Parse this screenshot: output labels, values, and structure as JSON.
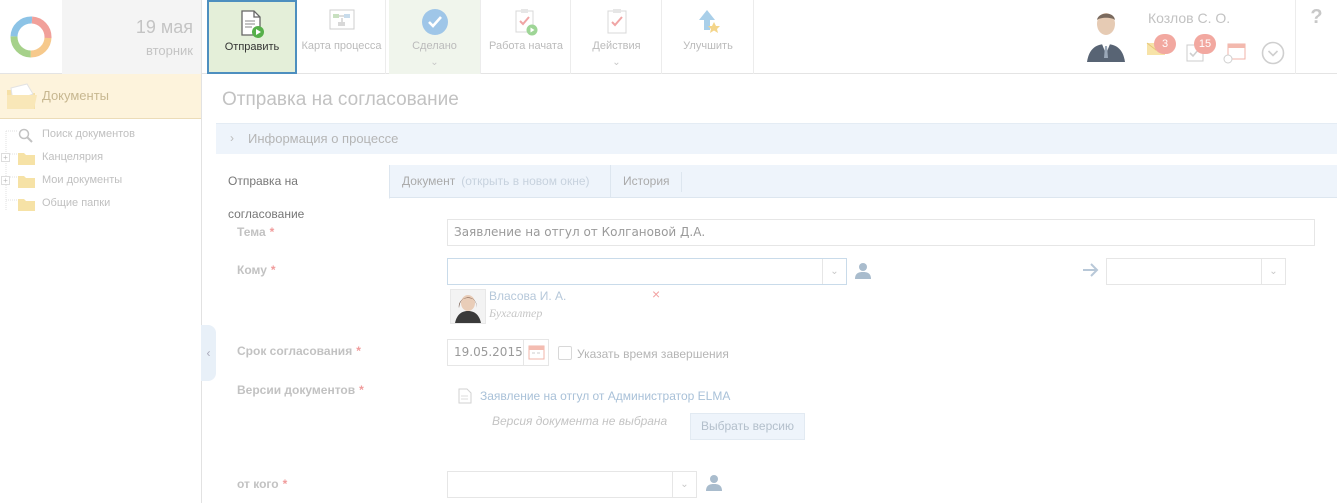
{
  "header": {
    "date_day": "19 мая",
    "date_weekday": "вторник",
    "toolbar": [
      {
        "key": "send",
        "label": "Отправить",
        "icon": "send-document-icon"
      },
      {
        "key": "map",
        "label": "Карта процесса",
        "icon": "process-map-icon"
      },
      {
        "key": "done",
        "label": "Сделано",
        "icon": "check-circle-icon"
      },
      {
        "key": "work",
        "label": "Работа начата",
        "icon": "task-start-icon"
      },
      {
        "key": "actions",
        "label": "Действия",
        "icon": "actions-icon"
      },
      {
        "key": "improve",
        "label": "Улучшить",
        "icon": "improve-icon"
      }
    ],
    "user_name": "Козлов С. О.",
    "messages_count": "3",
    "tasks_count": "15",
    "help_label": "?"
  },
  "sidebar": {
    "title": "Документы",
    "items": [
      {
        "label": "Поиск документов",
        "icon": "search-icon",
        "expandable": false
      },
      {
        "label": "Канцелярия",
        "icon": "folder-icon",
        "expandable": true
      },
      {
        "label": "Мои документы",
        "icon": "folder-icon",
        "expandable": true
      },
      {
        "label": "Общие папки",
        "icon": "folder-icon",
        "expandable": false
      }
    ]
  },
  "main": {
    "title": "Отправка на согласование",
    "info_section": "Информация о процессе",
    "tabs": {
      "send": "Отправка на согласование",
      "document": "Документ",
      "document_hint": "(открыть в новом окне)",
      "history": "История"
    },
    "form": {
      "subject_label": "Тема",
      "subject_value": "Заявление на отгул от Колгановой Д.А.",
      "to_label": "Кому",
      "to_value": "",
      "assignee_name": "Власова И. А.",
      "assignee_role": "Бухгалтер",
      "remove_symbol": "×",
      "deadline_label": "Срок согласования",
      "deadline_value": "19.05.2015",
      "specify_time_label": "Указать время завершения",
      "versions_label": "Версии документов",
      "doc_link": "Заявление на отгул от Администратор ELMA",
      "version_not_selected": "Версия документа не выбрана",
      "choose_version_button": "Выбрать версию",
      "from_label": "от кого",
      "from_value": "",
      "required_mark": "*"
    }
  },
  "colors": {
    "accent_blue": "#4d8fbf",
    "send_bg": "#e4efd9",
    "required": "#f09b9b",
    "badge": "#f2a8a0"
  }
}
